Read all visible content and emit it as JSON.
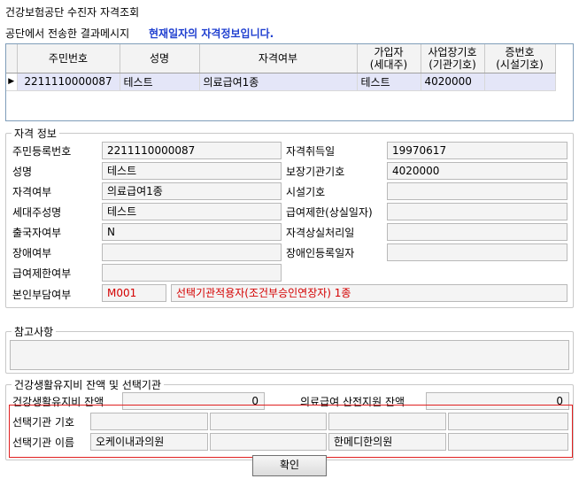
{
  "window": {
    "title": "건강보험공단 수진자 자격조회"
  },
  "message": {
    "label": "공단에서 전송한 결과메시지",
    "value": "현재일자의 자격정보입니다."
  },
  "grid": {
    "columns": [
      "주민번호",
      "성명",
      "자격여부",
      "가입자\n(세대주)",
      "사업장기호\n(기관기호)",
      "증번호\n(시설기호)"
    ],
    "row_marker": "▶",
    "rows": [
      [
        "2211110000087",
        "테스트",
        "의료급여1종",
        "테스트",
        "4020000",
        ""
      ]
    ]
  },
  "qualification": {
    "legend": "자격 정보",
    "resident_no_label": "주민등록번호",
    "resident_no": "2211110000087",
    "acquire_date_label": "자격취득일",
    "acquire_date": "19970617",
    "name_label": "성명",
    "name": "테스트",
    "institution_code_label": "보장기관기호",
    "institution_code": "4020000",
    "status_label": "자격여부",
    "status": "의료급여1종",
    "facility_code_label": "시설기호",
    "facility_code": "",
    "householder_label": "세대주성명",
    "householder": "테스트",
    "benefit_limit_label": "급여제한(상실일자)",
    "benefit_limit": "",
    "departure_label": "출국자여부",
    "departure": "N",
    "loss_date_label": "자격상실처리일",
    "loss_date": "",
    "disability_label": "장애여부",
    "disability": "",
    "disability_reg_label": "장애인등록일자",
    "disability_reg": "",
    "benefit_restrict_label": "급여제한여부",
    "benefit_restrict": "",
    "copay_label": "본인부담여부",
    "copay_code": "M001",
    "copay_desc": "선택기관적용자(조건부승인연장자) 1종"
  },
  "remarks": {
    "legend": "참고사항",
    "value": ""
  },
  "health_fund": {
    "legend": "건강생활유지비 잔액 및 선택기관",
    "balance_label": "건강생활유지비 잔액",
    "balance": "0",
    "prenatal_label": "의료급여 산전지원 잔액",
    "prenatal": "0",
    "selected_code_label": "선택기관 기호",
    "selected_codes": [
      "",
      "",
      "",
      ""
    ],
    "selected_name_label": "선택기관 이름",
    "selected_names": [
      "오케이내과의원",
      "",
      "한메디한의원",
      ""
    ]
  },
  "ok_button": "확인"
}
